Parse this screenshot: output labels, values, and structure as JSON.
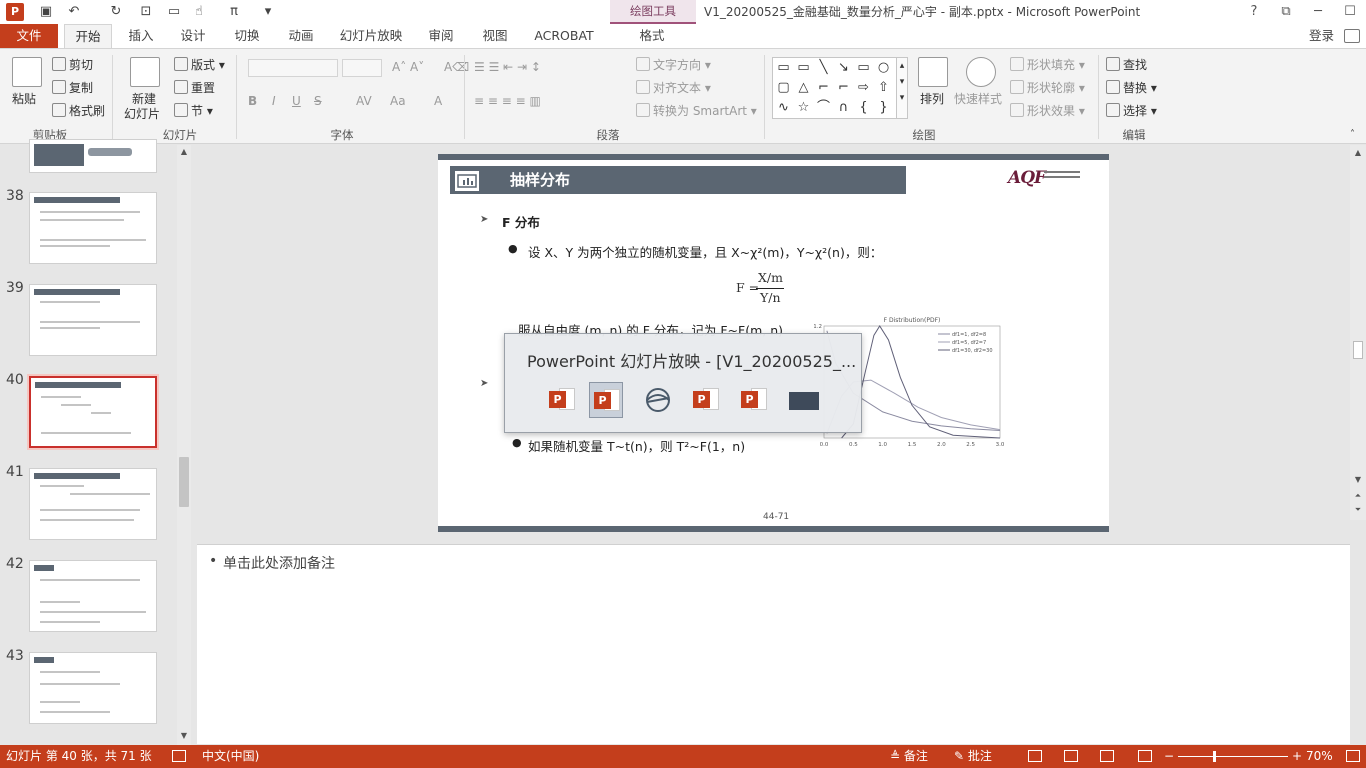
{
  "titlebar": {
    "drawing_tools": "绘图工具",
    "window_title": "V1_20200525_金融基础_数量分析_严心宇 - 副本.pptx - Microsoft PowerPoint"
  },
  "tabs": {
    "file": "文件",
    "items": [
      "开始",
      "插入",
      "设计",
      "切换",
      "动画",
      "幻灯片放映",
      "审阅",
      "视图",
      "ACROBAT",
      "格式"
    ],
    "login": "登录"
  },
  "ribbon": {
    "clipboard": {
      "paste": "粘贴",
      "cut": "剪切",
      "copy": "复制",
      "format_painter": "格式刷",
      "label": "剪贴板"
    },
    "slides": {
      "new_slide": "新建",
      "new_slide2": "幻灯片",
      "layout": "版式",
      "reset": "重置",
      "section": "节",
      "label": "幻灯片"
    },
    "font": {
      "label": "字体",
      "buttons": [
        "B",
        "I",
        "U",
        "S",
        "AV",
        "Aa",
        "A"
      ]
    },
    "paragraph": {
      "text_direction": "文字方向",
      "align_text": "对齐文本",
      "convert_smartart": "转换为 SmartArt",
      "label": "段落"
    },
    "drawing": {
      "arrange": "排列",
      "quick_styles": "快速样式",
      "shape_fill": "形状填充",
      "shape_outline": "形状轮廓",
      "shape_effects": "形状效果",
      "label": "绘图"
    },
    "editing": {
      "find": "查找",
      "replace": "替换",
      "select": "选择",
      "label": "编辑"
    }
  },
  "slide_panel": {
    "numbers": [
      "38",
      "39",
      "40",
      "41",
      "42",
      "43"
    ],
    "selected": "40"
  },
  "slide": {
    "title": "抽样分布",
    "heading": "F 分布",
    "bullet1": "设 X、Y 为两个独立的随机变量，且 X~χ²(m)，Y~χ²(n)，则：",
    "formula_lhs": "F =",
    "formula_num": "X/m",
    "formula_den": "Y/n",
    "line2": "服从自由度 (m, n) 的 F 分布，记为 F~F(m, n)",
    "bullet2": "如果随机变量 T~t(n)，则 T²~F(1，n)",
    "page": "44-71"
  },
  "chart_data": {
    "type": "line",
    "title": "F Distribution(PDF)",
    "xlim": [
      0,
      3.0
    ],
    "ylim": [
      0,
      1.2
    ],
    "x_ticks": [
      "0.0",
      "0.5",
      "1.0",
      "1.5",
      "2.0",
      "2.5",
      "3.0"
    ],
    "y_ticks": [
      "1.2"
    ],
    "series": [
      {
        "name": "df1=1, df2=8",
        "color": "#8a8aa0",
        "x": [
          0.05,
          0.2,
          0.5,
          1.0,
          1.5,
          2.0,
          2.5,
          3.0
        ],
        "values": [
          1.15,
          0.8,
          0.48,
          0.28,
          0.18,
          0.13,
          0.1,
          0.08
        ]
      },
      {
        "name": "df1=5, df2=7",
        "color": "#a0a0b4",
        "x": [
          0.05,
          0.3,
          0.5,
          0.8,
          1.2,
          1.6,
          2.0,
          2.5,
          3.0
        ],
        "values": [
          0.05,
          0.45,
          0.6,
          0.62,
          0.48,
          0.33,
          0.22,
          0.14,
          0.09
        ]
      },
      {
        "name": "df1=30, df2=30",
        "color": "#606078",
        "x": [
          0.3,
          0.5,
          0.7,
          0.85,
          0.95,
          1.1,
          1.3,
          1.5,
          1.8,
          2.2,
          3.0
        ],
        "values": [
          0.0,
          0.15,
          0.7,
          1.1,
          1.2,
          1.05,
          0.65,
          0.35,
          0.12,
          0.03,
          0.0
        ]
      }
    ]
  },
  "preview": {
    "title": "PowerPoint 幻灯片放映 - [V1_20200525_..."
  },
  "notes": {
    "placeholder": "单击此处添加备注"
  },
  "statusbar": {
    "slide_info": "幻灯片 第 40 张，共 71 张",
    "language": "中文(中国)",
    "notes_btn": "备注",
    "comments_btn": "批注",
    "zoom": "70%"
  }
}
